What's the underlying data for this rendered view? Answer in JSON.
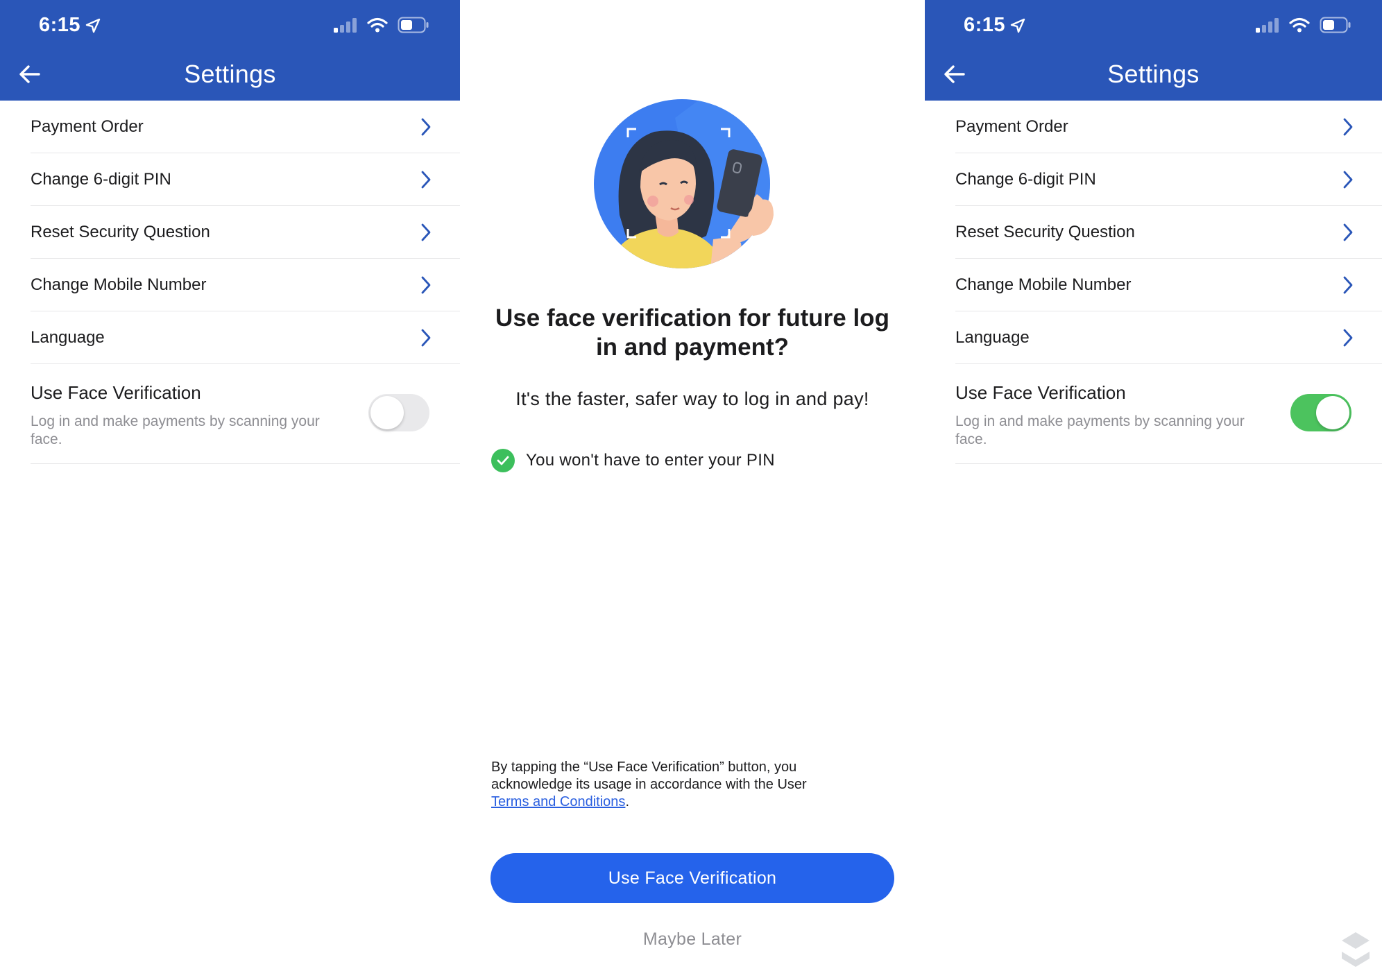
{
  "status_bar": {
    "time": "6:15"
  },
  "header": {
    "title": "Settings"
  },
  "settings": {
    "items": [
      {
        "label": "Payment Order"
      },
      {
        "label": "Change 6-digit PIN"
      },
      {
        "label": "Reset Security Question"
      },
      {
        "label": "Change Mobile Number"
      },
      {
        "label": "Language"
      }
    ],
    "face_verification": {
      "title": "Use Face Verification",
      "description": "Log in and make payments by scanning your face."
    }
  },
  "toggle_state": {
    "left": "off",
    "right": "on"
  },
  "prompt": {
    "title": "Use face verification for future log in and payment?",
    "subtitle": "It's the faster, safer way to log in and pay!",
    "benefit": "You won't have to enter your PIN",
    "disclaimer_text": "By tapping the “Use Face Verification” button, you acknowledge its usage in accordance with the User",
    "terms_link": "Terms and Conditions",
    "disclaimer_end": ".",
    "primary_button": "Use Face Verification",
    "secondary_button": "Maybe Later"
  },
  "colors": {
    "header_bg": "#2a56b8",
    "primary_button": "#2563eb",
    "toggle_on": "#4cc35e",
    "check_green": "#3cbf5c"
  },
  "icons": [
    "location-arrow-icon",
    "signal-icon",
    "wifi-icon",
    "battery-icon",
    "back-arrow-icon",
    "chevron-right-icon",
    "check-icon"
  ]
}
